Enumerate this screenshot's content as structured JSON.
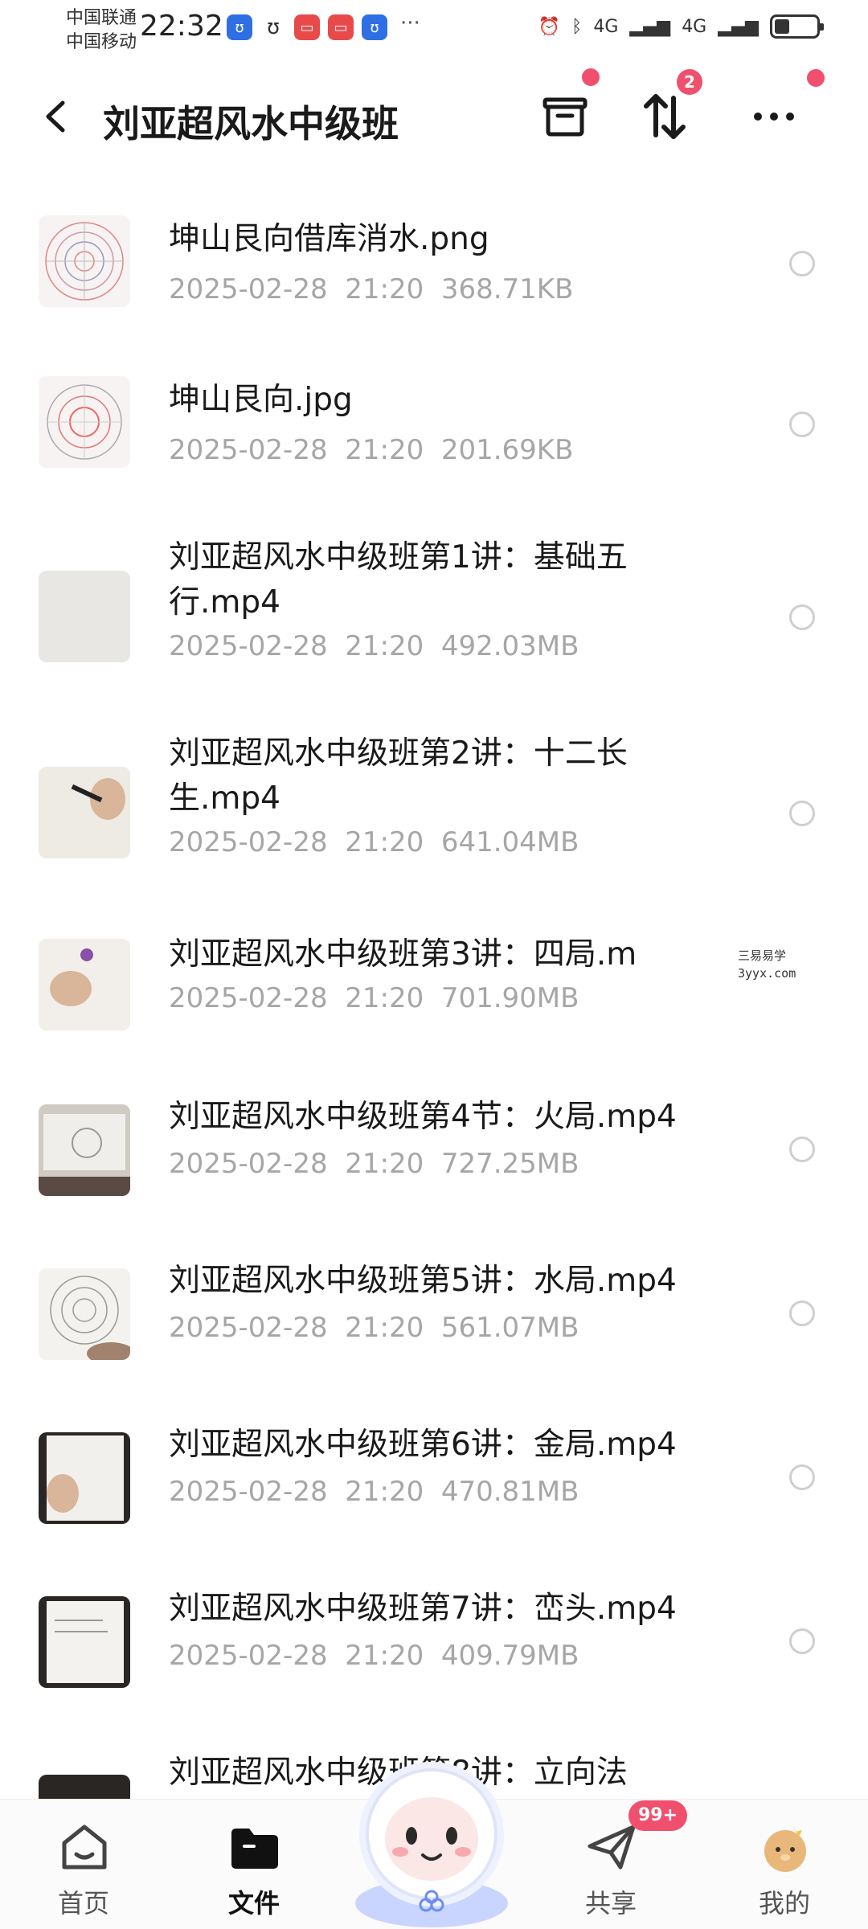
{
  "status_bar": {
    "carrier_1": "中国联通",
    "carrier_2": "中国移动",
    "time": "22:32",
    "network_1": "4G",
    "network_2": "4G",
    "battery_level": 0.35
  },
  "header": {
    "title": "刘亚超风水中级班",
    "transfer_badge": "2"
  },
  "files": [
    {
      "name": "坤山艮向借库消水.png",
      "date": "2025-02-28",
      "time": "21:20",
      "size": "368.71KB",
      "thumb": "chart"
    },
    {
      "name": "坤山艮向.jpg",
      "date": "2025-02-28",
      "time": "21:20",
      "size": "201.69KB",
      "thumb": "chart"
    },
    {
      "name": "刘亚超风水中级班第1讲：基础五行.mp4",
      "date": "2025-02-28",
      "time": "21:20",
      "size": "492.03MB",
      "thumb": "video"
    },
    {
      "name": "刘亚超风水中级班第2讲：十二长生.mp4",
      "date": "2025-02-28",
      "time": "21:20",
      "size": "641.04MB",
      "thumb": "video"
    },
    {
      "name": "刘亚超风水中级班第3讲：四局.m",
      "date": "2025-02-28",
      "time": "21:20",
      "size": "701.90MB",
      "thumb": "video"
    },
    {
      "name": "刘亚超风水中级班第4节：火局.mp4",
      "date": "2025-02-28",
      "time": "21:20",
      "size": "727.25MB",
      "thumb": "video-dark"
    },
    {
      "name": "刘亚超风水中级班第5讲：水局.mp4",
      "date": "2025-02-28",
      "time": "21:20",
      "size": "561.07MB",
      "thumb": "video"
    },
    {
      "name": "刘亚超风水中级班第6讲：金局.mp4",
      "date": "2025-02-28",
      "time": "21:20",
      "size": "470.81MB",
      "thumb": "video"
    },
    {
      "name": "刘亚超风水中级班第7讲：峦头.mp4",
      "date": "2025-02-28",
      "time": "21:20",
      "size": "409.79MB",
      "thumb": "video"
    },
    {
      "name": "刘亚超风水中级班第8讲：立向法",
      "date": "",
      "time": "",
      "size": "",
      "thumb": "video"
    }
  ],
  "watermark": {
    "line1": "三易易学",
    "line2": "3yyx.com"
  },
  "bottom_nav": {
    "home": "首页",
    "files": "文件",
    "share": "共享",
    "mine": "我的",
    "share_badge": "99+"
  },
  "colors": {
    "accent_red": "#f0506e",
    "meta_gray": "#a6a6a6"
  }
}
